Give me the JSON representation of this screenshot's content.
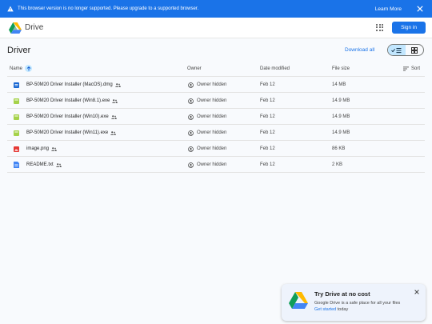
{
  "banner": {
    "message": "This browser version is no longer supported. Please upgrade to a supported browser.",
    "learn_more": "Learn More",
    "warning_icon": "warning-icon",
    "close_icon": "close-icon"
  },
  "header": {
    "brand": "Drive",
    "sign_in": "Sign in",
    "apps_icon": "apps-grid-icon"
  },
  "folder": {
    "title": "Driver",
    "download_all": "Download all"
  },
  "columns": {
    "name": "Name",
    "owner": "Owner",
    "date_modified": "Date modified",
    "file_size": "File size",
    "sort": "Sort"
  },
  "files": [
    {
      "name": "BP-50M20 Driver Installer (MacOS).dmg",
      "type": "dmg",
      "owner": "Owner hidden",
      "date": "Feb 12",
      "size": "14 MB"
    },
    {
      "name": "BP-50M20 Driver Installer (Win8.1).exe",
      "type": "exe",
      "owner": "Owner hidden",
      "date": "Feb 12",
      "size": "14.9 MB"
    },
    {
      "name": "BP-50M20 Driver Installer (Win10).exe",
      "type": "exe",
      "owner": "Owner hidden",
      "date": "Feb 12",
      "size": "14.9 MB"
    },
    {
      "name": "BP-50M20 Driver Installer (Win11).exe",
      "type": "exe",
      "owner": "Owner hidden",
      "date": "Feb 12",
      "size": "14.9 MB"
    },
    {
      "name": "image.png",
      "type": "image",
      "owner": "Owner hidden",
      "date": "Feb 12",
      "size": "86 KB"
    },
    {
      "name": "README.txt",
      "type": "text",
      "owner": "Owner hidden",
      "date": "Feb 12",
      "size": "2 KB"
    }
  ],
  "promo": {
    "title": "Try Drive at no cost",
    "description": "Google Drive is a safe place for all your files",
    "cta_link": "Get started",
    "cta_suffix": " today"
  },
  "colors": {
    "accent": "#1a73e8",
    "selected": "#c2e7ff",
    "dmg": "#1967d2",
    "exe": "#a5d24a",
    "image": "#e53935",
    "text": "#4285f4"
  }
}
